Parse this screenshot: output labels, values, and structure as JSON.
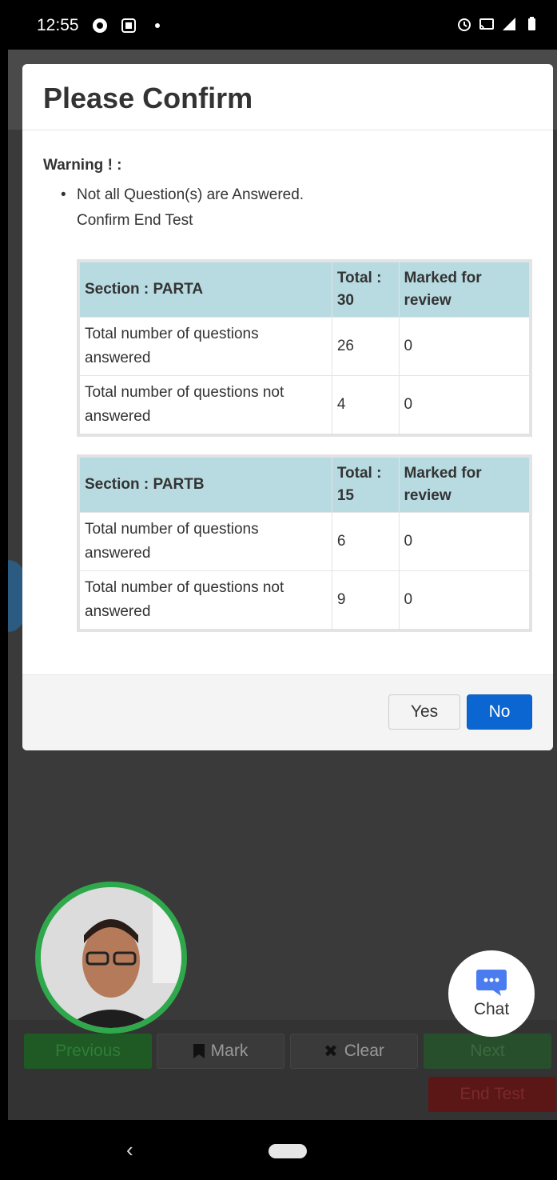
{
  "status_bar": {
    "time": "12:55"
  },
  "modal": {
    "title": "Please Confirm",
    "warning_label": "Warning ! :",
    "warning_message_line1": "Not all Question(s) are Answered.",
    "warning_message_line2": "Confirm End Test",
    "sections": [
      {
        "header": "Section : PARTA",
        "total_label": "Total :",
        "total_value": "30",
        "marked_header": "Marked for review",
        "rows": [
          {
            "label": "Total number of questions answered",
            "count": "26",
            "marked": "0"
          },
          {
            "label": "Total number of questions not answered",
            "count": "4",
            "marked": "0"
          }
        ]
      },
      {
        "header": "Section : PARTB",
        "total_label": "Total :",
        "total_value": "15",
        "marked_header": "Marked for review",
        "rows": [
          {
            "label": "Total number of questions answered",
            "count": "6",
            "marked": "0"
          },
          {
            "label": "Total number of questions not answered",
            "count": "9",
            "marked": "0"
          }
        ]
      }
    ],
    "yes_label": "Yes",
    "no_label": "No"
  },
  "chat": {
    "label": "Chat"
  },
  "bottom_bar": {
    "previous": "Previous",
    "mark": "Mark",
    "clear": "Clear",
    "next": "Next",
    "end_test": "End Test"
  },
  "colors": {
    "primary_button": "#0b66d1",
    "table_header": "#b8dbe2",
    "video_ring": "#2ea84b",
    "chat_icon": "#4a7cf0"
  }
}
